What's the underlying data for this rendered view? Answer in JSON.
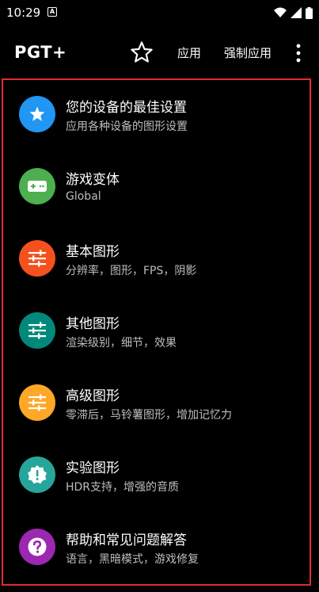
{
  "status_bar": {
    "time": "10:29",
    "notification_icon": "a-notification-icon",
    "right_icons": [
      "wifi-icon",
      "signal-icon",
      "battery-icon"
    ]
  },
  "app_bar": {
    "title": "PGT+",
    "favorite_icon": "star-outline-icon",
    "apply_label": "应用",
    "force_apply_label": "强制应用",
    "more_icon": "more-vert-icon"
  },
  "menu": {
    "items": [
      {
        "title": "您的设备的最佳设置",
        "subtitle": "应用各种设备的图形设置",
        "icon": "star-icon",
        "color": "#2196f3"
      },
      {
        "title": "游戏变体",
        "subtitle": "Global",
        "icon": "gamepad-icon",
        "color": "#4caf50"
      },
      {
        "title": "基本图形",
        "subtitle": "分辨率，图形，FPS，阴影",
        "icon": "tune-icon",
        "color": "#f4511e"
      },
      {
        "title": "其他图形",
        "subtitle": "渲染级别，细节，效果",
        "icon": "tune-icon",
        "color": "#00897b"
      },
      {
        "title": "高级图形",
        "subtitle": "零滞后，马铃薯图形，增加记忆力",
        "icon": "tune-icon",
        "color": "#ffa726"
      },
      {
        "title": "实验图形",
        "subtitle": "HDR支持，增强的音质",
        "icon": "alert-badge-icon",
        "color": "#26a69a"
      },
      {
        "title": "帮助和常见问题解答",
        "subtitle": "语言，黑暗模式，游戏修复",
        "icon": "help-icon",
        "color": "#9c27b0"
      }
    ]
  },
  "colors": {
    "background": "#000000",
    "frame_border": "#e22a35",
    "subtitle_text": "#bdbdbd"
  }
}
